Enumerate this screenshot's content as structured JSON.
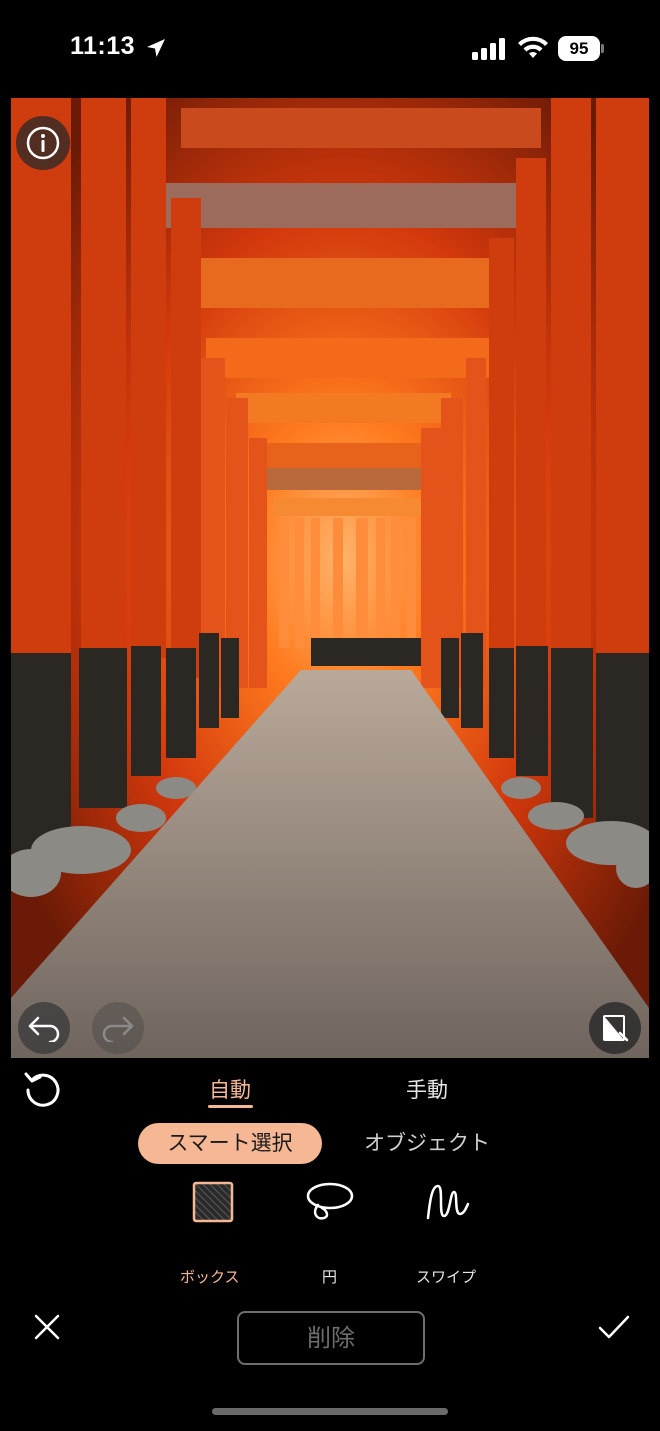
{
  "status_bar": {
    "time": "11:13",
    "battery": "95",
    "icons": [
      "location-arrow-icon",
      "signal-bars-icon",
      "wifi-icon",
      "battery-icon"
    ]
  },
  "photo": {
    "description_icon": "info-icon",
    "undo_icon": "undo-icon",
    "redo_icon": "redo-icon",
    "compare_icon": "compare-icon"
  },
  "mode_tabs": [
    {
      "label": "自動",
      "selected": true
    },
    {
      "label": "手動",
      "selected": false
    }
  ],
  "selection_modes": [
    {
      "label": "スマート選択",
      "selected": true
    },
    {
      "label": "オブジェクト",
      "selected": false
    }
  ],
  "tools": [
    {
      "label": "ボックス",
      "icon": "box-select-icon",
      "selected": true
    },
    {
      "label": "円",
      "icon": "lasso-circle-icon",
      "selected": false
    },
    {
      "label": "スワイプ",
      "icon": "swipe-squiggle-icon",
      "selected": false
    }
  ],
  "footer": {
    "delete_label": "削除",
    "cancel_icon": "close-icon",
    "confirm_icon": "checkmark-icon"
  },
  "colors": {
    "accent": "#f6b794",
    "background": "#000000",
    "disabled": "#6e6e6e"
  }
}
